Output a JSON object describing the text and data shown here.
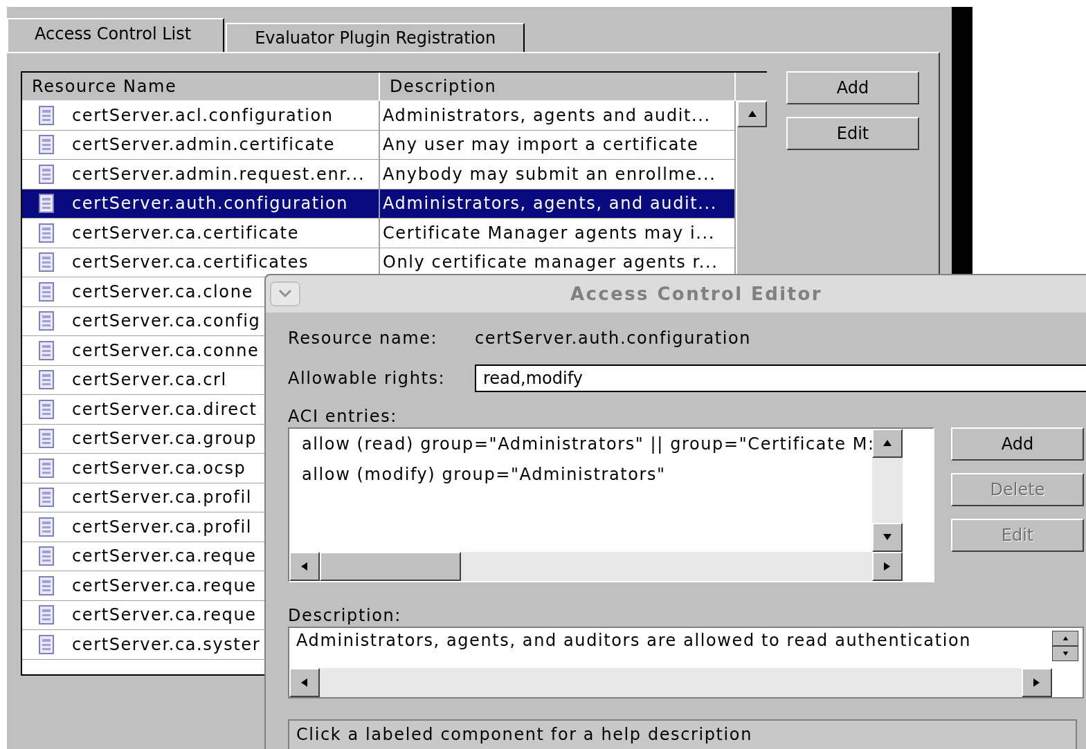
{
  "tabs": [
    {
      "label": "Access Control List",
      "selected": true
    },
    {
      "label": "Evaluator Plugin Registration",
      "selected": false
    }
  ],
  "table": {
    "columns": [
      "Resource Name",
      "Description"
    ],
    "rows": [
      {
        "name": "certServer.acl.configuration",
        "description": "Administrators, agents and audit...",
        "selected": false
      },
      {
        "name": "certServer.admin.certificate",
        "description": "Any user may import a certificate",
        "selected": false
      },
      {
        "name": "certServer.admin.request.enr...",
        "description": "Anybody may submit an enrollme...",
        "selected": false
      },
      {
        "name": "certServer.auth.configuration",
        "description": "Administrators, agents, and audit...",
        "selected": true
      },
      {
        "name": "certServer.ca.certificate",
        "description": "Certificate Manager agents may i...",
        "selected": false
      },
      {
        "name": "certServer.ca.certificates",
        "description": "Only certificate manager agents r...",
        "selected": false
      },
      {
        "name": "certServer.ca.clone",
        "selected": false
      },
      {
        "name": "certServer.ca.config",
        "selected": false
      },
      {
        "name": "certServer.ca.conne",
        "selected": false
      },
      {
        "name": "certServer.ca.crl",
        "selected": false
      },
      {
        "name": "certServer.ca.direct",
        "selected": false
      },
      {
        "name": "certServer.ca.group",
        "selected": false
      },
      {
        "name": "certServer.ca.ocsp",
        "selected": false
      },
      {
        "name": "certServer.ca.profil",
        "selected": false
      },
      {
        "name": "certServer.ca.profil",
        "selected": false
      },
      {
        "name": "certServer.ca.reque",
        "selected": false
      },
      {
        "name": "certServer.ca.reque",
        "selected": false
      },
      {
        "name": "certServer.ca.reque",
        "selected": false
      },
      {
        "name": "certServer.ca.syster",
        "selected": false
      }
    ]
  },
  "side_buttons": [
    "Add",
    "Edit"
  ],
  "dialog": {
    "title": "Access Control Editor",
    "resource_name_label": "Resource name:",
    "resource_name": "certServer.auth.configuration",
    "rights_label": "Allowable rights:",
    "rights_value": "read,modify",
    "aci_label": "ACI entries:",
    "aci_entries": [
      "allow (read) group=\"Administrators\" || group=\"Certificate M:",
      "allow (modify) group=\"Administrators\""
    ],
    "buttons": [
      {
        "label": "Add",
        "disabled": false
      },
      {
        "label": "Delete",
        "disabled": true
      },
      {
        "label": "Edit",
        "disabled": true
      }
    ],
    "description_label": "Description:",
    "description": "Administrators, agents, and auditors are allowed to read authentication",
    "help": "Click a labeled component for a help description"
  }
}
